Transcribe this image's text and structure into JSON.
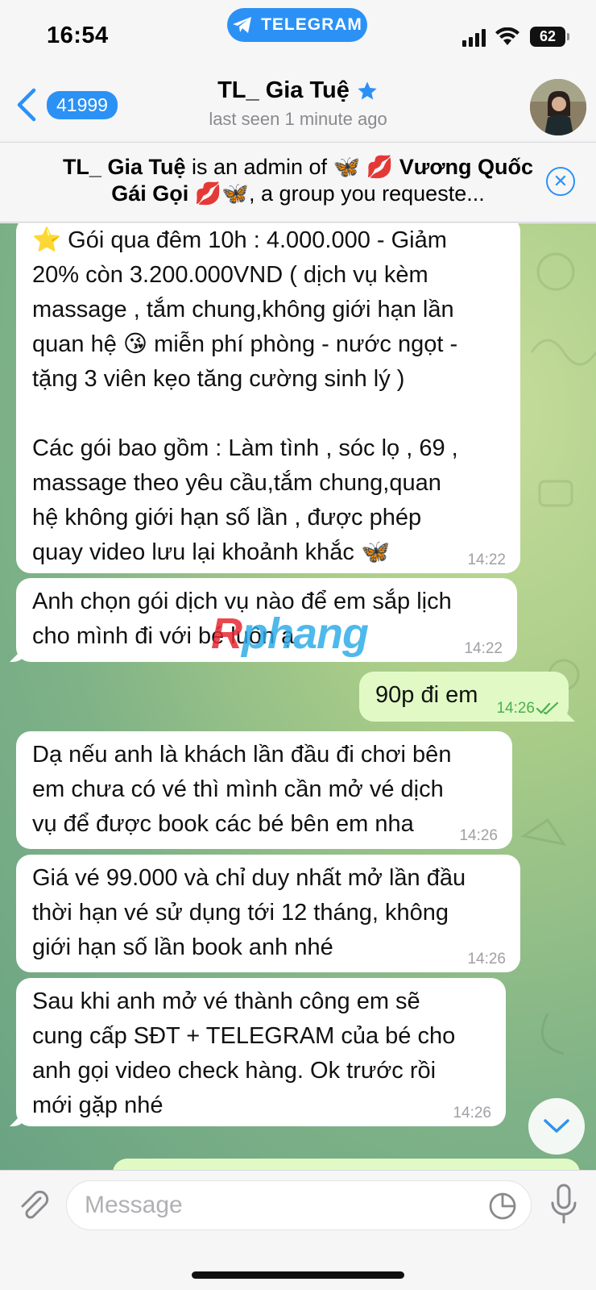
{
  "status_bar": {
    "time": "16:54",
    "app_pill": "TELEGRAM",
    "battery": "62"
  },
  "header": {
    "back_count": "41999",
    "title": "TL_ Gia Tuệ",
    "verified_icon": "star-icon",
    "subtitle": "last seen 1 minute ago"
  },
  "banner": {
    "name": "TL_ Gia Tuệ",
    "text_mid": " is an admin of ",
    "group_name": "🦋 💋 Vương Quốc Gái Gọi 💋🦋",
    "text_end": ", a group you requeste..."
  },
  "messages": [
    {
      "lines": [
        "⭐ Gói qua đêm 10h : 4.000.000 - Giảm",
        "20% còn 3.200.000VND  ( dịch vụ kèm",
        "massage , tắm chung,không giới hạn lần",
        "quan hệ 😘 miễn phí phòng - nước ngọt -",
        "tặng 3 viên kẹo tăng cường sinh lý )",
        "",
        "Các gói bao gồm : Làm tình , sóc lọ , 69 ,",
        "massage theo yêu cầu,tắm chung,quan",
        "hệ không giới hạn số lần , được phép",
        "quay video lưu lại khoảnh khắc 🦋"
      ],
      "time": "14:22"
    },
    {
      "lines": [
        "Anh chọn gói dịch vụ nào  để em sắp lịch",
        "cho mình đi với bé luôn ạ"
      ],
      "time": "14:22"
    },
    {
      "lines": [
        "90p đi em"
      ],
      "time": "14:26"
    },
    {
      "lines": [
        "Dạ nếu anh là khách lần đầu đi chơi bên",
        "em chưa có vé thì mình cần mở vé dịch",
        "vụ để được book các bé bên em nha"
      ],
      "time": "14:26"
    },
    {
      "lines": [
        "Giá vé 99.000 và chỉ duy nhất mở lần đầu",
        "thời hạn vé sử dụng tới 12 tháng, không",
        "giới hạn số lần book anh nhé"
      ],
      "time": "14:26"
    },
    {
      "lines": [
        "Sau khi anh mở vé thành công  em sẽ",
        "cung cấp SĐT + TELEGRAM của bé cho",
        "anh gọi video check hàng. Ok trước rồi",
        "mới gặp nhé"
      ],
      "time": "14:26"
    }
  ],
  "watermark": {
    "r": "R",
    "rest": "phang"
  },
  "input": {
    "placeholder": "Message"
  }
}
